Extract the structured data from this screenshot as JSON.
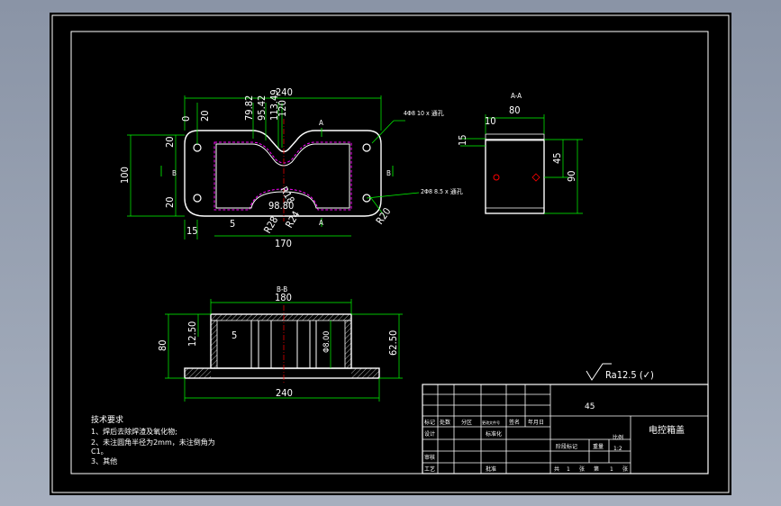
{
  "top_view": {
    "dims": {
      "overall_width": "240",
      "d_79_82": "79.82",
      "d_95_42": "95.42",
      "d_113_49": "113.49",
      "d_120": "120",
      "d_20_top": "20",
      "d_0": "0",
      "d_20_left_upper": "20",
      "d_20_left_lower": "20",
      "height_100": "100",
      "d_15_bottom": "15",
      "d_170": "170",
      "d_5": "5",
      "r_98_80": "98.80",
      "r_r18": "R18",
      "r_r24": "R24",
      "r_r28": "R28",
      "r_r20": "R20"
    },
    "section_marker_a": "A",
    "section_marker_b": "B",
    "hole_callout_top": "4Φ8 10 x 通孔",
    "hole_callout_side": "2Φ8 8.5 x 通孔"
  },
  "section_aa": {
    "title": "A-A",
    "dims": {
      "width": "80",
      "d_10": "10",
      "d_15": "15",
      "d_45": "45",
      "d_90": "90"
    }
  },
  "section_bb": {
    "title": "B-B",
    "dims": {
      "d_180": "180",
      "d_240": "240",
      "d_80": "80",
      "d_12_50": "12.50",
      "d_5": "5",
      "d_62_50": "62.50",
      "d_phi8": "Φ8.00"
    }
  },
  "roughness": "Ra12.5 (✓)",
  "notes": {
    "title": "技术要求",
    "items": [
      "1、焊后去除焊渣及氧化物;",
      "2、未注圆角半径为2mm，未注倒角为",
      "C1。",
      "3、其他"
    ]
  },
  "title_block": {
    "material": "45",
    "part_name": "电控箱盖",
    "scale": "1:2",
    "header_cells": [
      "标记",
      "处数",
      "分区",
      "更改文件号",
      "签名",
      "年月日"
    ],
    "row_labels": [
      "设计",
      "标准化",
      "审核",
      "工艺",
      "批准"
    ],
    "stage_cells": [
      "阶段标记",
      "重量",
      "比例"
    ],
    "sheet_text": [
      "共",
      "1",
      "张",
      "第",
      "1",
      "张"
    ]
  },
  "colors": {
    "outline": "#ffffff",
    "dimension": "#00ff00",
    "hidden": "#ff00ff",
    "center": "#ff0000",
    "hatch": "#ffffff"
  }
}
